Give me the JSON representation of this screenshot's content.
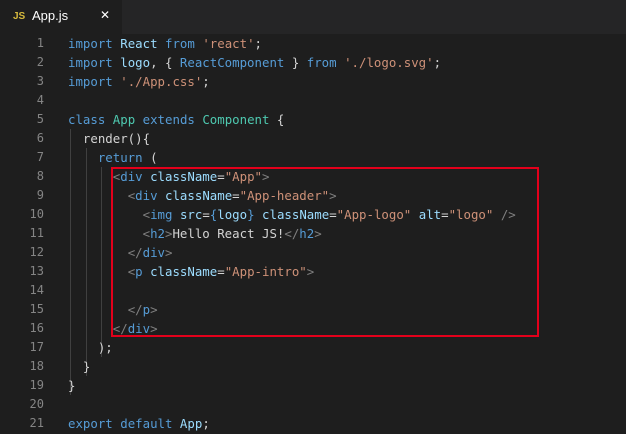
{
  "tab": {
    "badge": "JS",
    "filename": "App.js",
    "close": "✕"
  },
  "lines": [
    {
      "n": "1",
      "tokens": [
        {
          "t": "import",
          "c": "kw"
        },
        {
          "t": " ",
          "c": "plain"
        },
        {
          "t": "React",
          "c": "id"
        },
        {
          "t": " ",
          "c": "plain"
        },
        {
          "t": "from",
          "c": "kw"
        },
        {
          "t": " ",
          "c": "plain"
        },
        {
          "t": "'react'",
          "c": "str"
        },
        {
          "t": ";",
          "c": "plain"
        }
      ]
    },
    {
      "n": "2",
      "tokens": [
        {
          "t": "import",
          "c": "kw"
        },
        {
          "t": " ",
          "c": "plain"
        },
        {
          "t": "logo",
          "c": "id"
        },
        {
          "t": ", { ",
          "c": "plain"
        },
        {
          "t": "ReactComponent",
          "c": "kw"
        },
        {
          "t": " } ",
          "c": "plain"
        },
        {
          "t": "from",
          "c": "kw"
        },
        {
          "t": " ",
          "c": "plain"
        },
        {
          "t": "'./logo.svg'",
          "c": "str"
        },
        {
          "t": ";",
          "c": "plain"
        }
      ]
    },
    {
      "n": "3",
      "tokens": [
        {
          "t": "import",
          "c": "kw"
        },
        {
          "t": " ",
          "c": "plain"
        },
        {
          "t": "'./App.css'",
          "c": "str"
        },
        {
          "t": ";",
          "c": "plain"
        }
      ]
    },
    {
      "n": "4",
      "tokens": []
    },
    {
      "n": "5",
      "tokens": [
        {
          "t": "class",
          "c": "kw"
        },
        {
          "t": " ",
          "c": "plain"
        },
        {
          "t": "App",
          "c": "cls"
        },
        {
          "t": " ",
          "c": "plain"
        },
        {
          "t": "extends",
          "c": "kw"
        },
        {
          "t": " ",
          "c": "plain"
        },
        {
          "t": "Component",
          "c": "cls"
        },
        {
          "t": " {",
          "c": "plain"
        }
      ]
    },
    {
      "n": "6",
      "tokens": [
        {
          "t": "  render(){",
          "c": "plain"
        }
      ]
    },
    {
      "n": "7",
      "tokens": [
        {
          "t": "    ",
          "c": "plain"
        },
        {
          "t": "return",
          "c": "kw"
        },
        {
          "t": " (",
          "c": "plain"
        }
      ]
    },
    {
      "n": "8",
      "tokens": [
        {
          "t": "      ",
          "c": "plain"
        },
        {
          "t": "<",
          "c": "brk"
        },
        {
          "t": "div",
          "c": "tag"
        },
        {
          "t": " ",
          "c": "plain"
        },
        {
          "t": "className",
          "c": "attr"
        },
        {
          "t": "=",
          "c": "plain"
        },
        {
          "t": "\"App\"",
          "c": "str"
        },
        {
          "t": ">",
          "c": "brk"
        }
      ]
    },
    {
      "n": "9",
      "tokens": [
        {
          "t": "        ",
          "c": "plain"
        },
        {
          "t": "<",
          "c": "brk"
        },
        {
          "t": "div",
          "c": "tag"
        },
        {
          "t": " ",
          "c": "plain"
        },
        {
          "t": "className",
          "c": "attr"
        },
        {
          "t": "=",
          "c": "plain"
        },
        {
          "t": "\"App-header\"",
          "c": "str"
        },
        {
          "t": ">",
          "c": "brk"
        }
      ]
    },
    {
      "n": "10",
      "tokens": [
        {
          "t": "          ",
          "c": "plain"
        },
        {
          "t": "<",
          "c": "brk"
        },
        {
          "t": "img",
          "c": "tag"
        },
        {
          "t": " ",
          "c": "plain"
        },
        {
          "t": "src",
          "c": "attr"
        },
        {
          "t": "=",
          "c": "plain"
        },
        {
          "t": "{",
          "c": "kw"
        },
        {
          "t": "logo",
          "c": "id"
        },
        {
          "t": "}",
          "c": "kw"
        },
        {
          "t": " ",
          "c": "plain"
        },
        {
          "t": "className",
          "c": "attr"
        },
        {
          "t": "=",
          "c": "plain"
        },
        {
          "t": "\"App-logo\"",
          "c": "str"
        },
        {
          "t": " ",
          "c": "plain"
        },
        {
          "t": "alt",
          "c": "attr"
        },
        {
          "t": "=",
          "c": "plain"
        },
        {
          "t": "\"logo\"",
          "c": "str"
        },
        {
          "t": " />",
          "c": "brk"
        }
      ]
    },
    {
      "n": "11",
      "tokens": [
        {
          "t": "          ",
          "c": "plain"
        },
        {
          "t": "<",
          "c": "brk"
        },
        {
          "t": "h2",
          "c": "tag"
        },
        {
          "t": ">",
          "c": "brk"
        },
        {
          "t": "Hello React JS!",
          "c": "plain"
        },
        {
          "t": "</",
          "c": "brk"
        },
        {
          "t": "h2",
          "c": "tag"
        },
        {
          "t": ">",
          "c": "brk"
        }
      ]
    },
    {
      "n": "12",
      "tokens": [
        {
          "t": "        ",
          "c": "plain"
        },
        {
          "t": "</",
          "c": "brk"
        },
        {
          "t": "div",
          "c": "tag"
        },
        {
          "t": ">",
          "c": "brk"
        }
      ]
    },
    {
      "n": "13",
      "tokens": [
        {
          "t": "        ",
          "c": "plain"
        },
        {
          "t": "<",
          "c": "brk"
        },
        {
          "t": "p",
          "c": "tag"
        },
        {
          "t": " ",
          "c": "plain"
        },
        {
          "t": "className",
          "c": "attr"
        },
        {
          "t": "=",
          "c": "plain"
        },
        {
          "t": "\"App-intro\"",
          "c": "str"
        },
        {
          "t": ">",
          "c": "brk"
        }
      ]
    },
    {
      "n": "14",
      "tokens": []
    },
    {
      "n": "15",
      "tokens": [
        {
          "t": "        ",
          "c": "plain"
        },
        {
          "t": "</",
          "c": "brk"
        },
        {
          "t": "p",
          "c": "tag"
        },
        {
          "t": ">",
          "c": "brk"
        }
      ]
    },
    {
      "n": "16",
      "tokens": [
        {
          "t": "      ",
          "c": "plain"
        },
        {
          "t": "</",
          "c": "brk"
        },
        {
          "t": "div",
          "c": "tag"
        },
        {
          "t": ">",
          "c": "brk"
        }
      ]
    },
    {
      "n": "17",
      "tokens": [
        {
          "t": "    );",
          "c": "plain"
        }
      ]
    },
    {
      "n": "18",
      "tokens": [
        {
          "t": "  }",
          "c": "plain"
        }
      ]
    },
    {
      "n": "19",
      "tokens": [
        {
          "t": "}",
          "c": "plain"
        }
      ]
    },
    {
      "n": "20",
      "tokens": []
    },
    {
      "n": "21",
      "tokens": [
        {
          "t": "export",
          "c": "kw"
        },
        {
          "t": " ",
          "c": "plain"
        },
        {
          "t": "default",
          "c": "kw"
        },
        {
          "t": " ",
          "c": "plain"
        },
        {
          "t": "App",
          "c": "id"
        },
        {
          "t": ";",
          "c": "plain"
        }
      ]
    }
  ],
  "colors": {
    "highlight_border": "#e3001b",
    "background": "#1e1e1e"
  }
}
